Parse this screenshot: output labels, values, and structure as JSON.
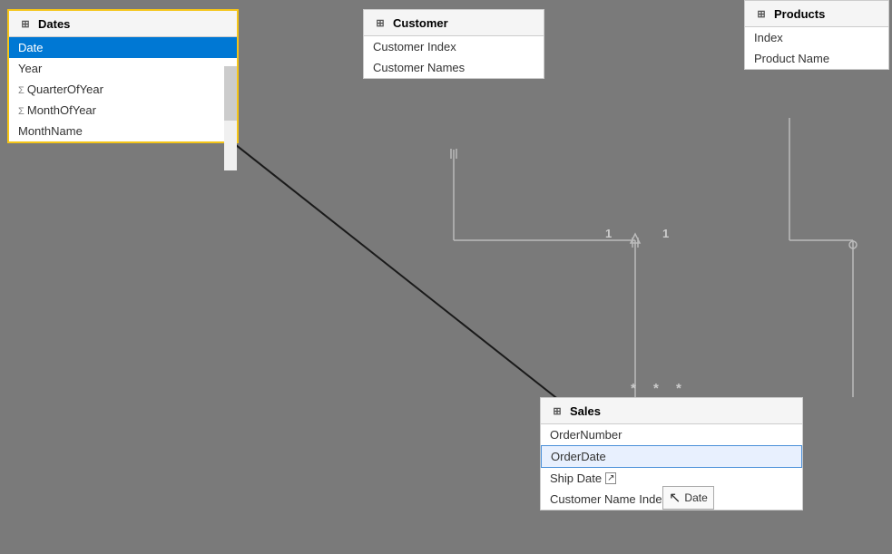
{
  "dates": {
    "title": "Dates",
    "fields": [
      {
        "name": "Date",
        "type": "normal",
        "selected": true
      },
      {
        "name": "Year",
        "type": "normal"
      },
      {
        "name": "QuarterOfYear",
        "type": "sigma"
      },
      {
        "name": "MonthOfYear",
        "type": "sigma"
      },
      {
        "name": "MonthName",
        "type": "normal"
      }
    ]
  },
  "customer": {
    "title": "Customer",
    "fields": [
      {
        "name": "Customer Index"
      },
      {
        "name": "Customer Names"
      }
    ]
  },
  "products": {
    "title": "Products",
    "fields": [
      {
        "name": "Index"
      },
      {
        "name": "Product Name"
      }
    ]
  },
  "sales": {
    "title": "Sales",
    "fields": [
      {
        "name": "OrderNumber",
        "selected": false
      },
      {
        "name": "OrderDate",
        "selected": true
      },
      {
        "name": "Ship Date",
        "selected": false
      },
      {
        "name": "Customer Name Index",
        "selected": false
      }
    ]
  },
  "tooltip": {
    "text": "Date",
    "icon": "↗"
  },
  "relationship_labels": {
    "one_customer": "1",
    "one_products": "1",
    "many_sales_1": "*",
    "many_sales_2": "*",
    "many_sales_3": "*"
  }
}
